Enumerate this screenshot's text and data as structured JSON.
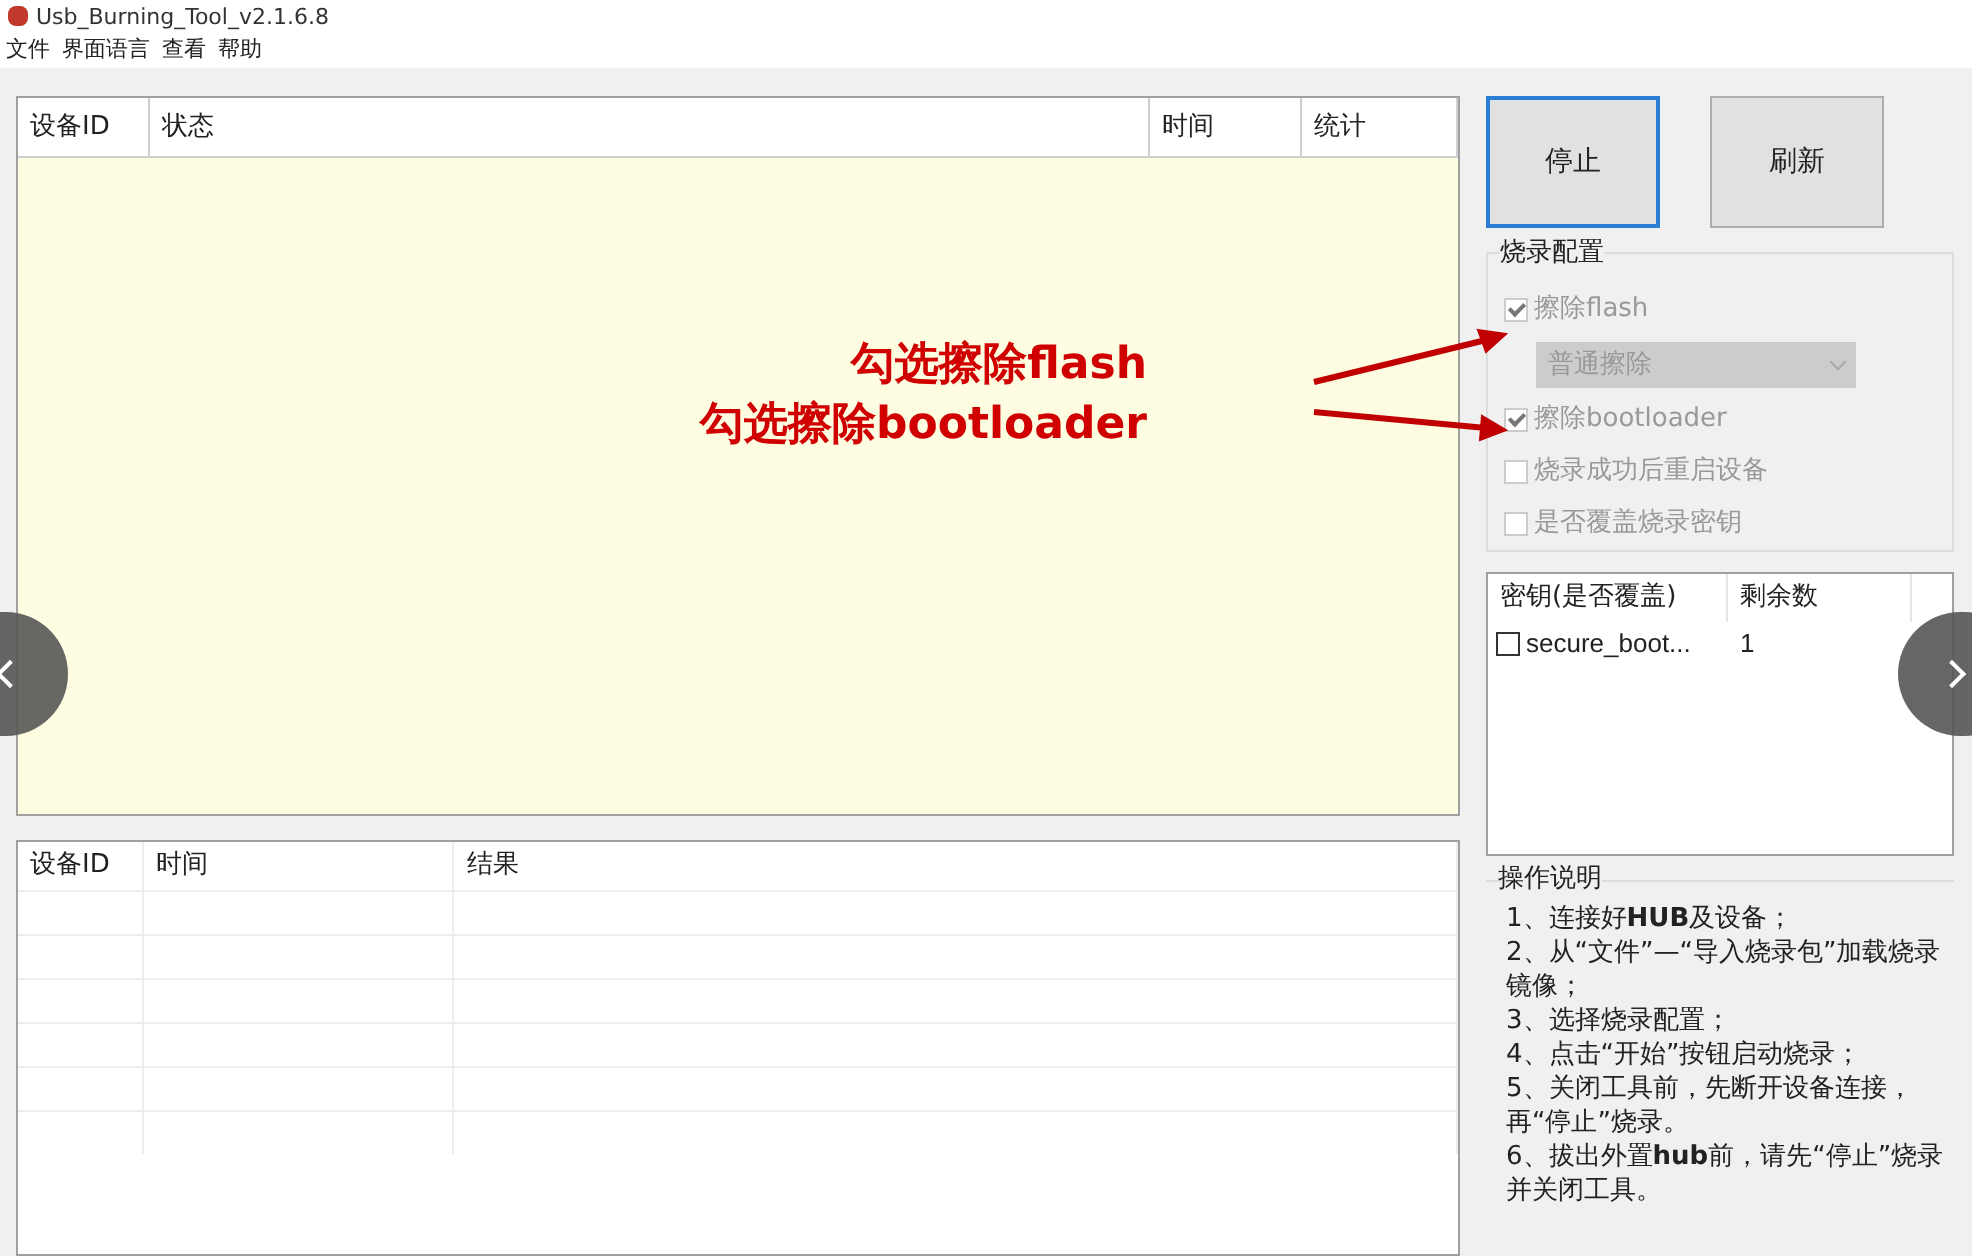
{
  "window": {
    "title": "Usb_Burning_Tool_v2.1.6.8"
  },
  "menu": [
    "文件",
    "界面语言",
    "查看",
    "帮助"
  ],
  "device_table": {
    "columns": [
      "设备ID",
      "状态",
      "时间",
      "统计"
    ]
  },
  "result_table": {
    "columns": [
      "设备ID",
      "时间",
      "结果"
    ]
  },
  "buttons": [
    {
      "label": "停止",
      "focused": true
    },
    {
      "label": "刷新",
      "focused": false
    }
  ],
  "burn_config": {
    "title": "烧录配置",
    "options": [
      {
        "kind": "checkbox",
        "label": "擦除flash",
        "checked": true,
        "disabled": true
      },
      {
        "kind": "dropdown",
        "value": "普通擦除",
        "disabled": true
      },
      {
        "kind": "checkbox",
        "label": "擦除bootloader",
        "checked": true,
        "disabled": true
      },
      {
        "kind": "checkbox",
        "label": "烧录成功后重启设备",
        "checked": false,
        "disabled": true
      },
      {
        "kind": "checkbox",
        "label": "是否覆盖烧录密钥",
        "checked": false,
        "disabled": true
      }
    ]
  },
  "key_table": {
    "columns": [
      "密钥(是否覆盖)",
      "剩余数"
    ],
    "rows": [
      {
        "name": "secure_boot...",
        "remaining": "1",
        "checked": false
      }
    ]
  },
  "instructions": {
    "title": "操作说明",
    "steps": [
      "1、连接好**HUB**及设备；",
      "2、从“文件”—“导入烧录包”加载烧录镜像；",
      "3、选择烧录配置；",
      "4、点击“开始”按钮启动烧录；",
      "5、关闭工具前，先断开设备连接，再“停止”烧录。",
      "6、拔出外置**hub**前，请先“停止”烧录并关闭工具。"
    ]
  },
  "annotations": [
    "勾选擦除flash",
    "勾选擦除bootloader"
  ]
}
